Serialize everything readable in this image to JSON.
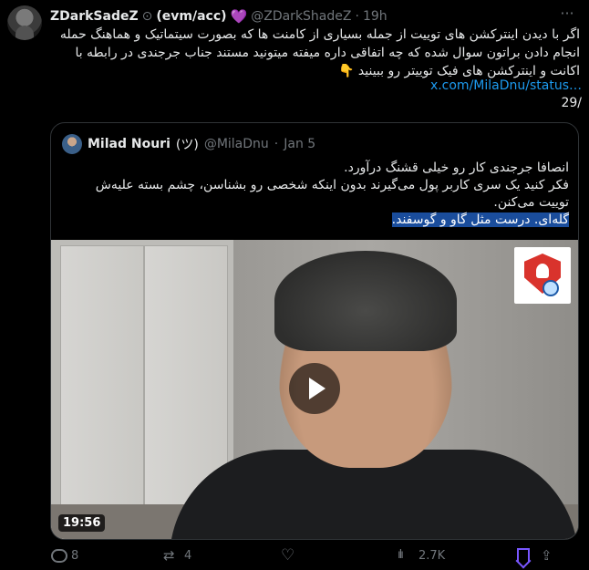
{
  "tweet": {
    "display_name": "ZDarkSadeZ",
    "name_suffix": "(evm/acc)",
    "handle": "@ZDarkShadeZ",
    "time": "19h",
    "text": "اگر با دیدن اینترکشن های توییت از جمله بسیاری از کامنت ها که بصورت سیتماتیک و هماهنگ حمله انجام دادن براتون سوال شده که چه اتفاقی داره میفته میتونید مستند جناب جرجندی در رابطه با اکانت و اینترکشن های فیک توییتر رو ببینید 👇",
    "link": "x.com/MilaDnu/status…",
    "counter": "29/"
  },
  "quote": {
    "name": "Milad Nouri",
    "name_emoji": "(ツ)",
    "handle": "@MilaDnu",
    "date": "Jan 5",
    "lines": [
      "انصافا جرجندی کار رو خیلی قشنگ درآورد.",
      "فکر کنید یک سری کاربر پول می‌گیرند بدون اینکه شخصی رو بشناسن، چشم بسته علیه‌ش توییت می‌کنن.",
      "گله‌ای. درست مثل گاو و گوسفند."
    ],
    "video_duration": "19:56"
  },
  "actions": {
    "replies": "8",
    "reposts": "4",
    "likes": "",
    "views": "2.7K"
  },
  "icons": [
    "verified-icon",
    "heart-emoji",
    "more-icon",
    "play-icon",
    "reply-icon",
    "repost-icon",
    "like-icon",
    "views-icon",
    "bookmark-icon",
    "share-icon"
  ],
  "colors": {
    "accent": "#1d9bf0",
    "bookmark": "#7856ff",
    "highlight": "#1a4d9c",
    "muted": "#71767b"
  }
}
